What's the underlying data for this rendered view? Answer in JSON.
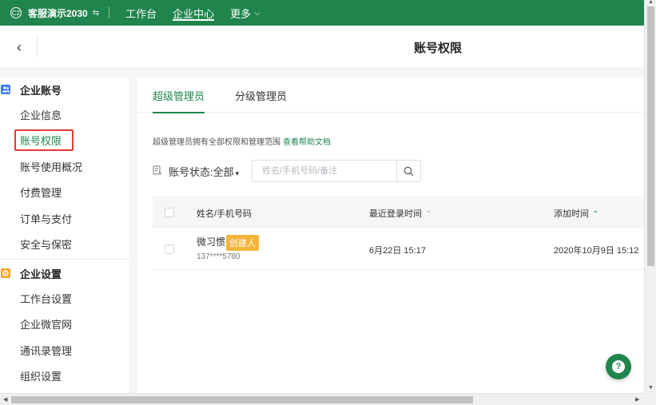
{
  "topbar": {
    "org_logo": "C2",
    "org_name": "客服演示2030",
    "switch_icon": "⇆",
    "nav": [
      {
        "label": "工作台",
        "active": false
      },
      {
        "label": "企业中心",
        "active": true
      },
      {
        "label": "更多",
        "active": false
      }
    ],
    "more_chevron": "⌵"
  },
  "header": {
    "back_icon": "‹",
    "title": "账号权限"
  },
  "sidebar": {
    "groups": [
      {
        "label": "企业账号",
        "icon": "users-icon",
        "items": [
          "企业信息",
          "账号权限",
          "账号使用概况",
          "付费管理",
          "订单与支付",
          "安全与保密"
        ]
      },
      {
        "label": "企业设置",
        "icon": "settings-icon",
        "items": [
          "工作台设置",
          "企业微官网",
          "通讯录管理",
          "组织设置"
        ]
      }
    ],
    "active_item": "账号权限"
  },
  "main": {
    "tabs": [
      {
        "label": "超级管理员",
        "active": true
      },
      {
        "label": "分级管理员",
        "active": false
      }
    ],
    "description": "超级管理员拥有全部权限和管理范围",
    "help_link": "查看帮助文档",
    "filter": {
      "label": "账号状态:",
      "value": "全部",
      "caret": "▾"
    },
    "search": {
      "placeholder": "姓名/手机号码/备注",
      "icon": "search-icon"
    },
    "table": {
      "columns": [
        "姓名/手机号码",
        "最近登录时间",
        "添加时间"
      ],
      "sort_icon": "⌃⌄",
      "rows": [
        {
          "name": "微习惯",
          "badge": "创建人",
          "phone": "137****5780",
          "last_login": "6月22日 15:17",
          "added": "2020年10月9日 15:12"
        }
      ]
    }
  },
  "help_fab": {
    "icon": "?"
  },
  "colors": {
    "brand": "#20854c",
    "highlight_border": "#e53935",
    "badge": "#f5b53a"
  }
}
